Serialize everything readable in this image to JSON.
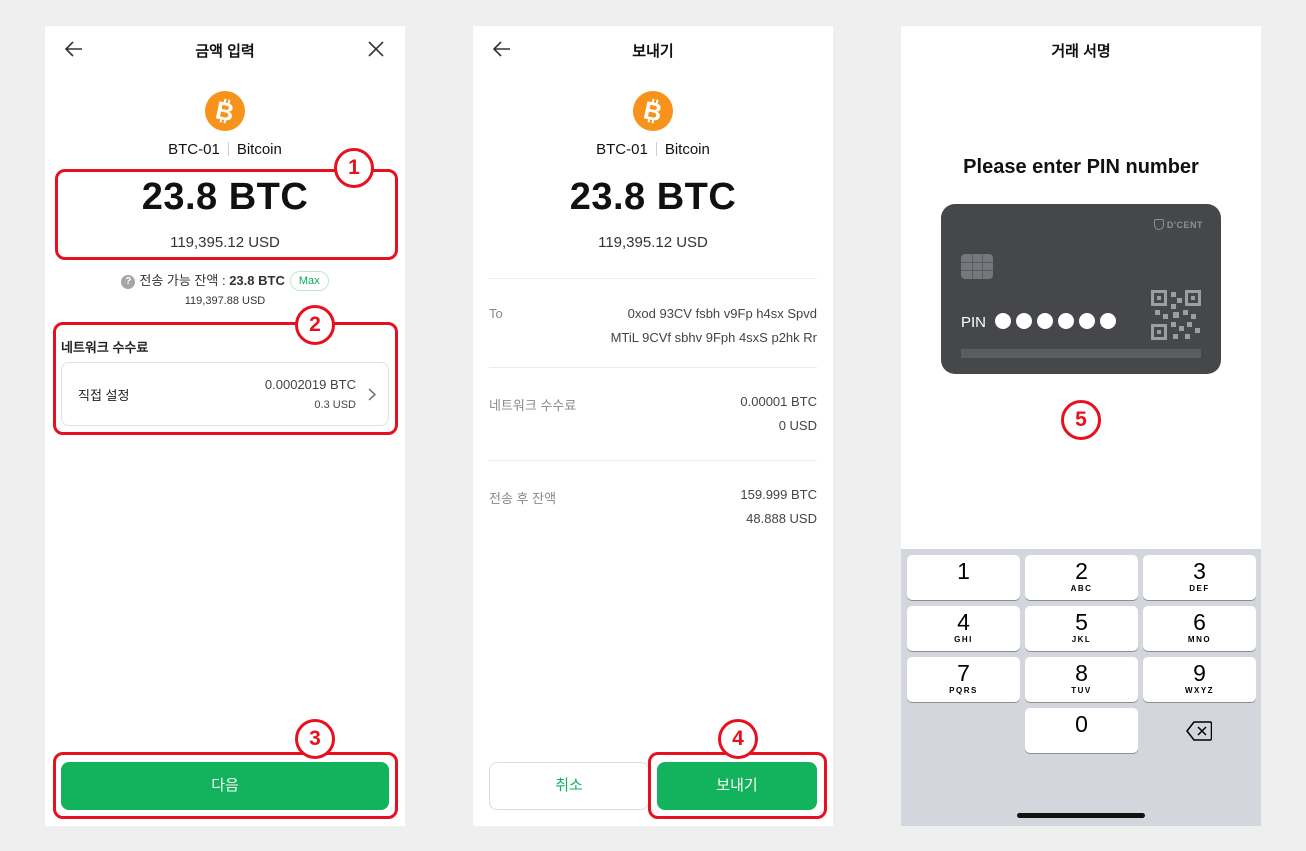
{
  "colors": {
    "accent_green": "#12b35c",
    "highlight_red": "#e8101f",
    "bitcoin_orange": "#f7931a",
    "card_bg": "#45474b"
  },
  "screen1": {
    "title": "금액 입력",
    "account_name": "BTC-01",
    "coin_name": "Bitcoin",
    "amount": "23.8 BTC",
    "amount_usd": "119,395.12 USD",
    "available_label": "전송 가능 잔액 :",
    "available_value": "23.8 BTC",
    "max_label": "Max",
    "available_usd": "119,397.88 USD",
    "fee_section_label": "네트워크 수수료",
    "fee_option_label": "직접 설정",
    "fee_btc": "0.0002019 BTC",
    "fee_usd": "0.3 USD",
    "next_label": "다음",
    "badge_1": "1",
    "badge_2": "2",
    "badge_3": "3"
  },
  "screen2": {
    "title": "보내기",
    "account_name": "BTC-01",
    "coin_name": "Bitcoin",
    "amount": "23.8 BTC",
    "amount_usd": "119,395.12 USD",
    "to_label": "To",
    "to_address_line1": "0xod 93CV fsbh v9Fp h4sx Spvd",
    "to_address_line2": "MTiL 9CVf sbhv 9Fph 4sxS p2hk Rr",
    "fee_label": "네트워크 수수료",
    "fee_btc": "0.00001 BTC",
    "fee_usd": "0 USD",
    "balance_after_label": "전송 후 잔액",
    "balance_btc": "159.999 BTC",
    "balance_usd": "48.888 USD",
    "cancel_label": "취소",
    "send_label": "보내기",
    "badge_4": "4"
  },
  "screen3": {
    "title": "거래 서명",
    "pin_prompt": "Please enter PIN number",
    "card_brand": "D'CENT",
    "card_pin_label": "PIN",
    "badge_5": "5",
    "keys": [
      {
        "num": "1",
        "letters": ""
      },
      {
        "num": "2",
        "letters": "ABC"
      },
      {
        "num": "3",
        "letters": "DEF"
      },
      {
        "num": "4",
        "letters": "GHI"
      },
      {
        "num": "5",
        "letters": "JKL"
      },
      {
        "num": "6",
        "letters": "MNO"
      },
      {
        "num": "7",
        "letters": "PQRS"
      },
      {
        "num": "8",
        "letters": "TUV"
      },
      {
        "num": "9",
        "letters": "WXYZ"
      },
      {
        "num": "0",
        "letters": ""
      }
    ]
  }
}
